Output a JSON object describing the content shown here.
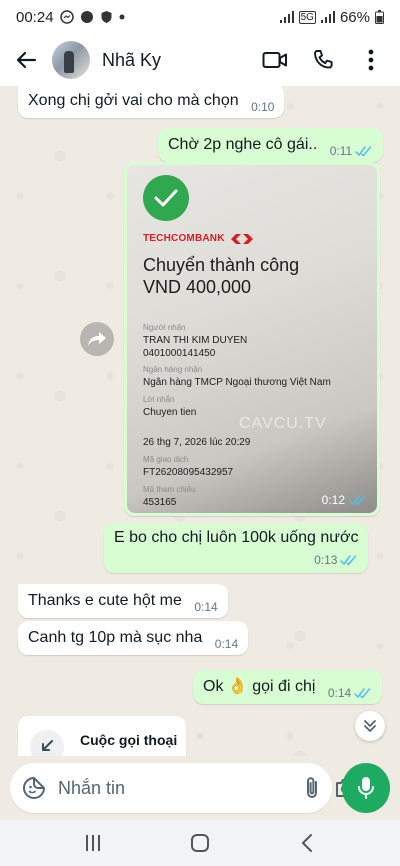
{
  "status_bar": {
    "time": "00:24",
    "battery": "66%",
    "network": "5G"
  },
  "header": {
    "contact_name": "Nhã Ky",
    "icons": [
      "back-arrow-icon",
      "video-call-icon",
      "phone-icon",
      "more-vert-icon"
    ]
  },
  "messages": [
    {
      "dir": "in",
      "text": "Xong chị gởi vai cho mà chọn",
      "time": "0:10"
    },
    {
      "dir": "out",
      "text": "Chờ 2p nghe cô gái..",
      "time": "0:11",
      "read": true
    },
    {
      "dir": "out",
      "type": "image",
      "time": "0:12",
      "read": true
    },
    {
      "dir": "out",
      "text": "E  bo cho chị luôn 100k uống nước",
      "time": "0:13",
      "read": true
    },
    {
      "dir": "in",
      "text": "Thanks e cute hột me",
      "time": "0:14"
    },
    {
      "dir": "in",
      "text": "Canh tg 10p mà sục nha",
      "time": "0:14"
    },
    {
      "dir": "out",
      "text": "Ok 👌 gọi đi chị",
      "time": "0:14",
      "read": true
    }
  ],
  "receipt": {
    "bank": "TECHCOMBANK",
    "title": "Chuyển thành công",
    "amount": "VND 400,000",
    "recipient_label": "Người nhận",
    "recipient_name": "TRAN THI KIM DUYEN",
    "account_number": "0401000141450",
    "bank_label": "Ngân hàng nhận",
    "receiving_bank": "Ngân hàng TMCP Ngoại thương Việt Nam",
    "note_label": "Lời nhắn",
    "note": "Chuyen tien",
    "date": "26 thg 7, 2026 lúc 20:29",
    "txn_label": "Mã giao dịch",
    "txn_id": "FT26208095432957",
    "ref_label": "Mã tham chiếu",
    "ref_id": "453165",
    "watermark": "CAVCU.TV"
  },
  "call_card": {
    "title": "Cuộc gọi thoại"
  },
  "input": {
    "placeholder": "Nhắn tin"
  },
  "colors": {
    "out_bubble": "#d9fdd3",
    "in_bubble": "#ffffff",
    "accent": "#1daa61",
    "read_ticks": "#53bdeb",
    "techcombank_red": "#d32027"
  }
}
